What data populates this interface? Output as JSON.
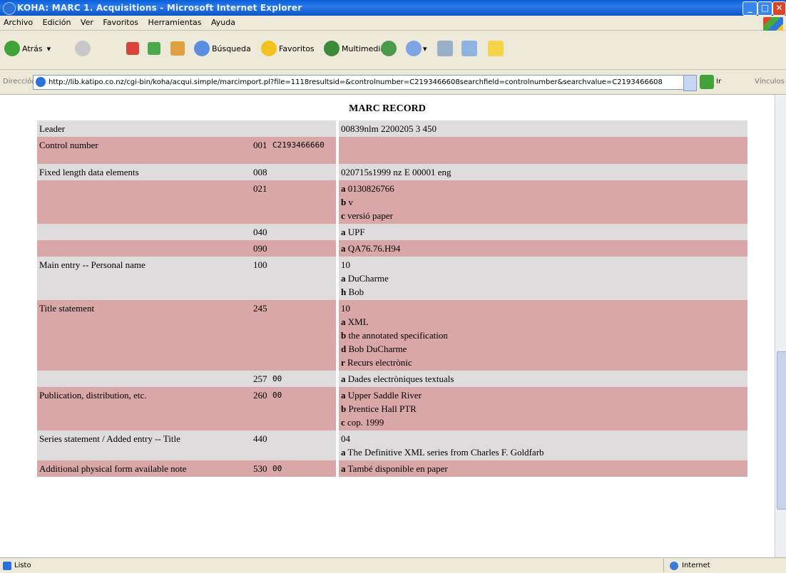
{
  "window": {
    "title": "KOHA: MARC 1. Acquisitions - Microsoft Internet Explorer"
  },
  "menu": [
    "Archivo",
    "Edición",
    "Ver",
    "Favoritos",
    "Herramientas",
    "Ayuda"
  ],
  "toolbar": {
    "back": "Atrás",
    "search": "Búsqueda",
    "favorites": "Favoritos",
    "media": "Multimedia"
  },
  "address": {
    "label": "Dirección",
    "url": "http://lib.katipo.co.nz/cgi-bin/koha/acqui.simple/marcimport.pl?file=1118resultsid=&controlnumber=C2193466608searchfield=controlnumber&searchvalue=C2193466608",
    "go": "Ir",
    "links": "Vínculos"
  },
  "record": {
    "heading": "MARC RECORD",
    "rows": [
      {
        "label": "Leader",
        "tag": "",
        "ind": "",
        "lines": [
          {
            "code": "",
            "text": "00839nlm 2200205 3 450"
          }
        ]
      },
      {
        "label": "Control number",
        "tag": "001",
        "ind": "C2193466660",
        "lines": []
      },
      {
        "label": "Fixed length data elements",
        "tag": "008",
        "ind": "",
        "lines": [
          {
            "code": "",
            "text": "020715s1999 nz E 00001 eng"
          }
        ]
      },
      {
        "label": "",
        "tag": "021",
        "ind": "",
        "lines": [
          {
            "code": "a",
            "text": "0130826766"
          },
          {
            "code": "b",
            "text": "v"
          },
          {
            "code": "c",
            "text": "versió paper"
          }
        ]
      },
      {
        "label": "",
        "tag": "040",
        "ind": "",
        "lines": [
          {
            "code": "a",
            "text": "UPF"
          }
        ]
      },
      {
        "label": "",
        "tag": "090",
        "ind": "",
        "lines": [
          {
            "code": "a",
            "text": "QA76.76.H94"
          }
        ]
      },
      {
        "label": "Main entry -- Personal name",
        "tag": "100",
        "ind": "",
        "lines": [
          {
            "code": "",
            "text": "10"
          },
          {
            "code": "a",
            "text": "DuCharme"
          },
          {
            "code": "h",
            "text": "Bob"
          }
        ]
      },
      {
        "label": "Title statement",
        "tag": "245",
        "ind": "",
        "lines": [
          {
            "code": "",
            "text": "10"
          },
          {
            "code": "a",
            "text": "XML"
          },
          {
            "code": "b",
            "text": "the annotated specification"
          },
          {
            "code": "d",
            "text": "Bob DuCharme"
          },
          {
            "code": "r",
            "text": "Recurs electrònic"
          }
        ]
      },
      {
        "label": "",
        "tag": "257",
        "ind": "00",
        "lines": [
          {
            "code": "a",
            "text": "Dades electròniques textuals"
          }
        ]
      },
      {
        "label": "Publication, distribution, etc.",
        "tag": "260",
        "ind": "00",
        "lines": [
          {
            "code": "a",
            "text": "Upper Saddle River"
          },
          {
            "code": "b",
            "text": "Prentice Hall PTR"
          },
          {
            "code": "c",
            "text": "cop. 1999"
          }
        ]
      },
      {
        "label": "Series statement / Added entry -- Title",
        "tag": "440",
        "ind": "",
        "lines": [
          {
            "code": "",
            "text": "04"
          },
          {
            "code": "a",
            "text": "The Definitive XML series from Charles F. Goldfarb"
          }
        ]
      },
      {
        "label": "Additional physical form available note",
        "tag": "530",
        "ind": "00",
        "lines": [
          {
            "code": "a",
            "text": "També disponible en paper"
          }
        ]
      }
    ]
  },
  "status": {
    "left": "Listo",
    "zone": "Internet"
  },
  "colors": {
    "row_gray": "#dedcdc",
    "row_pink": "#d9a7a8",
    "titlebar": "#0a5fd8"
  }
}
